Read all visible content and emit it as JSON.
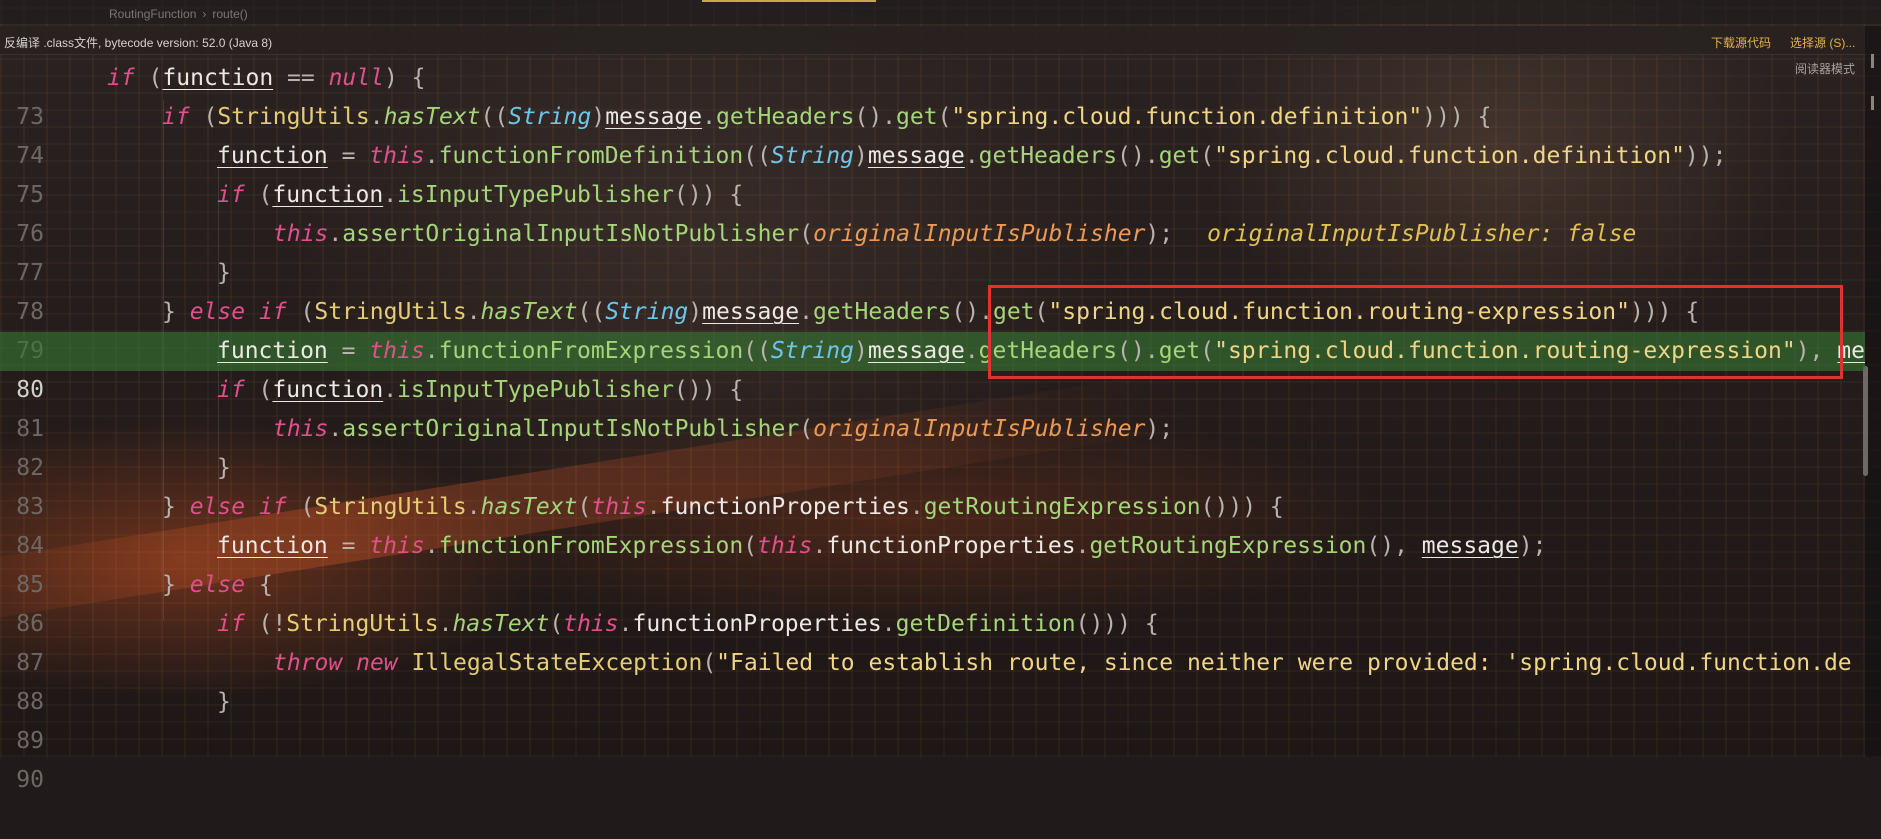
{
  "breadcrumb": {
    "class_name": "RoutingFunction",
    "method_name": "route()"
  },
  "banner": {
    "info": "反编译 .class文件, bytecode version: 52.0 (Java 8)",
    "download_source": "下载源代码",
    "choose_source": "选择源 (S)..."
  },
  "reader_mode": "阅读器模式",
  "current_line": "80",
  "inline_hint": "originalInputIsPublisher: false",
  "code": {
    "l73": {
      "num": "73",
      "kw_if": "if",
      "paren": " (",
      "var": "function",
      "op": " == ",
      "kw_null": "null",
      "close": ") {"
    },
    "l74": {
      "num": "74",
      "kw_if": "if",
      "p1": " (",
      "cls": "StringUtils",
      "dot1": ".",
      "m1": "hasText",
      "p2": "((",
      "cast": "String",
      "p3": ")",
      "var": "message",
      "dot2": ".",
      "m2": "getHeaders",
      "p4": "().",
      "m3": "get",
      "p5": "(",
      "str": "\"spring.cloud.function.definition\"",
      "p6": "))) {"
    },
    "l75": {
      "num": "75",
      "var": "function",
      "op": " = ",
      "kw_this": "this",
      "dot1": ".",
      "m1": "functionFromDefinition",
      "p1": "((",
      "cast": "String",
      "p2": ")",
      "var2": "message",
      "dot2": ".",
      "m2": "getHeaders",
      "p3": "().",
      "m3": "get",
      "p4": "(",
      "str": "\"spring.cloud.function.definition\"",
      "p5": "));"
    },
    "l76": {
      "num": "76",
      "kw_if": "if",
      "p1": " (",
      "var": "function",
      "dot": ".",
      "m": "isInputTypePublisher",
      "p2": "()) {"
    },
    "l77": {
      "num": "77",
      "kw_this": "this",
      "dot": ".",
      "m": "assertOriginalInputIsNotPublisher",
      "p1": "(",
      "param": "originalInputIsPublisher",
      "p2": ");"
    },
    "l78": {
      "num": "78",
      "brace": "}"
    },
    "l79": {
      "num": "79",
      "brace": "} ",
      "kw_else": "else",
      "sp": " ",
      "kw_if": "if",
      "p1": " (",
      "cls": "StringUtils",
      "dot1": ".",
      "m1": "hasText",
      "p2": "((",
      "cast": "String",
      "p3": ")",
      "var": "message",
      "dot2": ".",
      "m2": "getHeaders",
      "p4": "().",
      "m3": "get",
      "p5": "(",
      "str": "\"spring.cloud.function.routing-expression\"",
      "p6": "))) {"
    },
    "l80": {
      "num": "80",
      "var": "function",
      "op": " = ",
      "kw_this": "this",
      "dot1": ".",
      "m1": "functionFromExpression",
      "p1": "((",
      "cast": "String",
      "p2": ")",
      "var2": "message",
      "dot2": ".",
      "m2": "getHeaders",
      "p3": "().",
      "m3": "get",
      "p4": "(",
      "str": "\"spring.cloud.function.routing-expression\"",
      "p5": "), ",
      "tail": "me"
    },
    "l81": {
      "num": "81",
      "kw_if": "if",
      "p1": " (",
      "var": "function",
      "dot": ".",
      "m": "isInputTypePublisher",
      "p2": "()) {"
    },
    "l82": {
      "num": "82",
      "kw_this": "this",
      "dot": ".",
      "m": "assertOriginalInputIsNotPublisher",
      "p1": "(",
      "param": "originalInputIsPublisher",
      "p2": ");"
    },
    "l83": {
      "num": "83",
      "brace": "}"
    },
    "l84": {
      "num": "84",
      "brace": "} ",
      "kw_else": "else",
      "sp": " ",
      "kw_if": "if",
      "p1": " (",
      "cls": "StringUtils",
      "dot1": ".",
      "m1": "hasText",
      "p2": "(",
      "kw_this": "this",
      "dot2": ".",
      "fld": "functionProperties",
      "dot3": ".",
      "m2": "getRoutingExpression",
      "p3": "())) {"
    },
    "l85": {
      "num": "85",
      "var": "function",
      "op": " = ",
      "kw_this": "this",
      "dot1": ".",
      "m1": "functionFromExpression",
      "p1": "(",
      "kw_this2": "this",
      "dot2": ".",
      "fld": "functionProperties",
      "dot3": ".",
      "m2": "getRoutingExpression",
      "p2": "(), ",
      "var2": "message",
      "p3": ");"
    },
    "l86": {
      "num": "86",
      "brace": "} ",
      "kw_else": "else",
      "p": " {"
    },
    "l87": {
      "num": "87",
      "kw_if": "if",
      "p1": " (!",
      "cls": "StringUtils",
      "dot1": ".",
      "m1": "hasText",
      "p2": "(",
      "kw_this": "this",
      "dot2": ".",
      "fld": "functionProperties",
      "dot3": ".",
      "m2": "getDefinition",
      "p3": "())) {"
    },
    "l88": {
      "num": "88",
      "kw_throw": "throw",
      "sp": " ",
      "kw_new": "new",
      "sp2": " ",
      "cls": "IllegalStateException",
      "p1": "(",
      "str": "\"Failed to establish route, since neither were provided: 'spring.cloud.function.de"
    },
    "l89": {
      "num": "89",
      "brace": "}"
    },
    "l90": {
      "num": "90"
    }
  }
}
